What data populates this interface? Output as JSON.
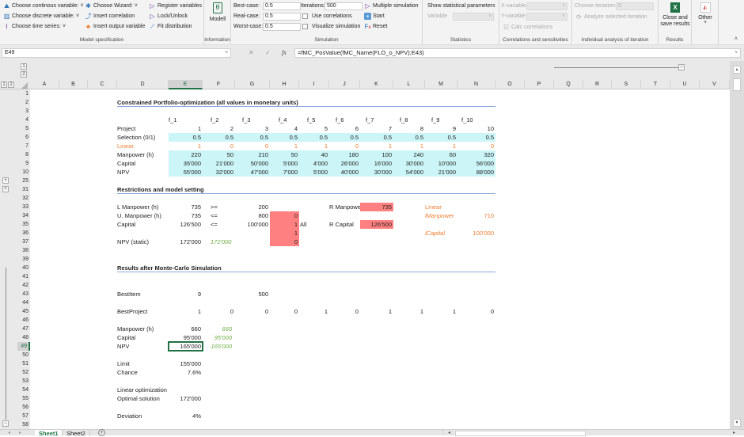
{
  "ribbon": {
    "model_spec": {
      "label": "Model specification",
      "choose_continuous": "Choose continous variable:",
      "choose_discrete": "Choose discrete variable:",
      "choose_time_series": "Choose time series:",
      "choose_wizard": "Choose Wizard:",
      "insert_correlation": "Insert correlation",
      "insert_output_variable": "Insert output variable",
      "register_variables": "Register variables",
      "lock_unlock": "Lock/Unlock",
      "fit_distribution": "Fit distribution"
    },
    "information": {
      "label": "Information",
      "modell": "Modell"
    },
    "simulation": {
      "label": "Simulation",
      "best_case_label": "Best-case:",
      "best_case_value": "0.5",
      "real_case_label": "Real-case:",
      "real_case_value": "0.5",
      "worst_case_label": "Worst-case:",
      "worst_case_value": "0.5",
      "iterations_label": "Iterations:",
      "iterations_value": "500",
      "use_correlations": "Use correlations",
      "visualize_simulation": "Visualize simulation",
      "multiple_simulation": "Multiple simulation",
      "start": "Start",
      "reset": "Reset"
    },
    "statistics": {
      "label": "Statistics",
      "show_params": "Show statistical parameters",
      "variable_label": "Variable"
    },
    "correlations": {
      "label": "Correlations and sensitivities",
      "x_variable": "X-variable",
      "y_variable": "Y-variable",
      "calc_correlations": "Calc correlations"
    },
    "iteration": {
      "label": "Individual analysis of iteration",
      "choose_iteration": "Choose iteration:",
      "iteration_value": "0",
      "analyze": "Analyze selected iteration"
    },
    "results": {
      "label": "Results",
      "close_save": "Close and save results"
    },
    "other": {
      "label": "Other"
    }
  },
  "formula_bar": {
    "name_box": "E49",
    "cancel": "✕",
    "enter": "✓",
    "fx": "fx",
    "formula": "=fMC_PosValue(fMC_Name(FLO_o_NPV);E43)"
  },
  "columns": [
    "A",
    "B",
    "C",
    "D",
    "E",
    "F",
    "G",
    "H",
    "I",
    "J",
    "K",
    "L",
    "M",
    "N",
    "O",
    "P",
    "Q",
    "R",
    "S",
    "T",
    "U",
    "V"
  ],
  "selected_column": "E",
  "rows": [
    "1",
    "2",
    "3",
    "4",
    "5",
    "6",
    "7",
    "8",
    "9",
    "10",
    "25",
    "31",
    "32",
    "33",
    "34",
    "35",
    "36",
    "37",
    "38",
    "39",
    "40",
    "41",
    "42",
    "43",
    "44",
    "45",
    "46",
    "47",
    "48",
    "49",
    "50",
    "51",
    "52",
    "53",
    "54",
    "55",
    "56",
    "57",
    "58"
  ],
  "selected_row": "49",
  "outline": {
    "levels": [
      "1",
      "2"
    ],
    "expand": "+",
    "collapse": "−"
  },
  "sheet": {
    "title1": "Constrained Portfolio-optimization (all values in monetary units)",
    "f_labels": [
      "f_1",
      "f_2",
      "f_3",
      "f_4",
      "f_5",
      "f_6",
      "f_7",
      "f_8",
      "f_9",
      "f_10"
    ],
    "table": [
      {
        "label": "Project",
        "values": [
          "1",
          "2",
          "3",
          "4",
          "5",
          "6",
          "7",
          "8",
          "9",
          "10"
        ],
        "style": ""
      },
      {
        "label": "Selection (0/1)",
        "values": [
          "0.5",
          "0.5",
          "0.5",
          "0.5",
          "0.5",
          "0.5",
          "0.5",
          "0.5",
          "0.5",
          "0.5"
        ],
        "style": "cyan"
      },
      {
        "label": "Linear",
        "values": [
          "1",
          "0",
          "0",
          "1",
          "1",
          "0",
          "1",
          "1",
          "1",
          "0"
        ],
        "style": "org"
      },
      {
        "label": "Manpower (h)",
        "values": [
          "220",
          "50",
          "210",
          "50",
          "40",
          "180",
          "100",
          "240",
          "60",
          "320"
        ],
        "style": "cyan"
      },
      {
        "label": "Capital",
        "values": [
          "35'000",
          "21'000",
          "50'000",
          "5'000",
          "4'000",
          "26'000",
          "16'000",
          "30'000",
          "10'000",
          "56'000"
        ],
        "style": "cyan"
      },
      {
        "label": "NPV",
        "values": [
          "55'000",
          "32'000",
          "47'000",
          "7'000",
          "5'000",
          "40'000",
          "30'000",
          "54'000",
          "21'000",
          "88'000"
        ],
        "style": "cyan"
      }
    ],
    "title2": "Restrictions and model setting",
    "restrictions": {
      "l_manpower": {
        "label": "L Manpower (h)",
        "value": "735",
        "op": ">=",
        "limit": "200"
      },
      "u_manpower": {
        "label": "U. Manpower (h)",
        "value": "735",
        "op": "<=",
        "limit": "800",
        "flag": "0"
      },
      "capital": {
        "label": "Capital",
        "value": "126'500",
        "op": "<=",
        "limit": "100'000",
        "flag": "1",
        "all": "All"
      },
      "flag_row36": "1",
      "npv_static": {
        "label": "NPV (static)",
        "value": "172'000",
        "check": "172'000",
        "flag": "0"
      },
      "r_manpower": {
        "label": "R Manpower",
        "value": "735"
      },
      "r_capital": {
        "label": "R Capital",
        "value": "126'500"
      },
      "linear_label": "Linear",
      "l_manpower_lin": {
        "label": "lManpower",
        "value": "710"
      },
      "l_capital_lin": {
        "label": "lCapital",
        "value": "100'000"
      }
    },
    "title3": "Results after Monte-Carlo Simulation",
    "results": {
      "best_item": {
        "label": "BestItem",
        "value": "9",
        "iterations": "500"
      },
      "best_project": {
        "label": "BestProject",
        "values": [
          "1",
          "0",
          "0",
          "0",
          "1",
          "0",
          "1",
          "1",
          "1",
          "0"
        ]
      },
      "manpower": {
        "label": "Manpower (h)",
        "value": "660",
        "check": "660"
      },
      "capital": {
        "label": "Capital",
        "value": "95'000",
        "check": "95'000"
      },
      "npv": {
        "label": "NPV",
        "value": "165'000",
        "check": "165'000"
      },
      "limit": {
        "label": "Limit",
        "value": "155'000"
      },
      "chance": {
        "label": "Chance",
        "value": "7.6%"
      },
      "linear_opt": {
        "label": "Linear optimization"
      },
      "optimal_solution": {
        "label": "Optimal solution",
        "value": "172'000"
      },
      "deviation": {
        "label": "Deviation",
        "value": "4%"
      }
    }
  },
  "tabs": {
    "sheet1": "Sheet1",
    "sheet2": "Sheet2",
    "add": "+"
  },
  "colors": {
    "accent": "#217346",
    "cyan": "#ccf5f8",
    "pink": "#ff8080",
    "orange": "#ed7d31",
    "green": "#70ad47",
    "title_rule": "#8eaadb"
  }
}
